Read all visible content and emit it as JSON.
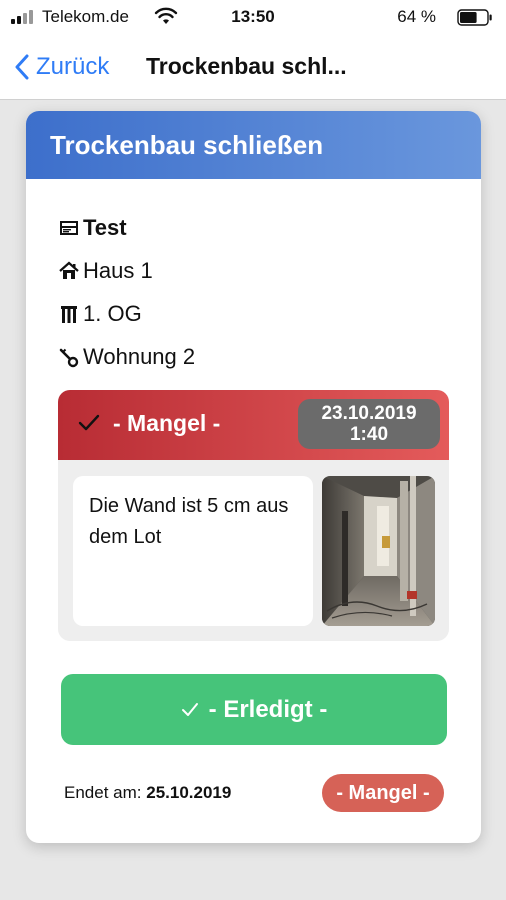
{
  "status_bar": {
    "carrier": "Telekom.de",
    "time": "13:50",
    "battery": "64 %",
    "battery_level": 0.64,
    "icons": [
      "signal-icon",
      "wifi-icon",
      "battery-icon"
    ]
  },
  "nav": {
    "back_label": "Zurück",
    "title": "Trockenbau schl..."
  },
  "card": {
    "title": "Trockenbau schließen",
    "info": [
      {
        "icon": "document-icon",
        "text": "Test"
      },
      {
        "icon": "house-icon",
        "text": "Haus 1"
      },
      {
        "icon": "floor-icon",
        "text": "1. OG"
      },
      {
        "icon": "key-icon",
        "text": "Wohnung 2"
      }
    ]
  },
  "defect": {
    "title": "- Mangel -",
    "date": "23.10.2019",
    "time": "1:40",
    "description": "Die Wand ist 5 cm aus dem Lot"
  },
  "done_button": {
    "label": "- Erledigt -"
  },
  "footer": {
    "label": "Endet am:",
    "date": "25.10.2019",
    "badge": "- Mangel -"
  },
  "colors": {
    "header_blue": "#4a7fd6",
    "defect_red": "#c9343b",
    "done_green": "#46c47a",
    "badge_red": "#d66257",
    "link_blue": "#2f7cf6"
  }
}
